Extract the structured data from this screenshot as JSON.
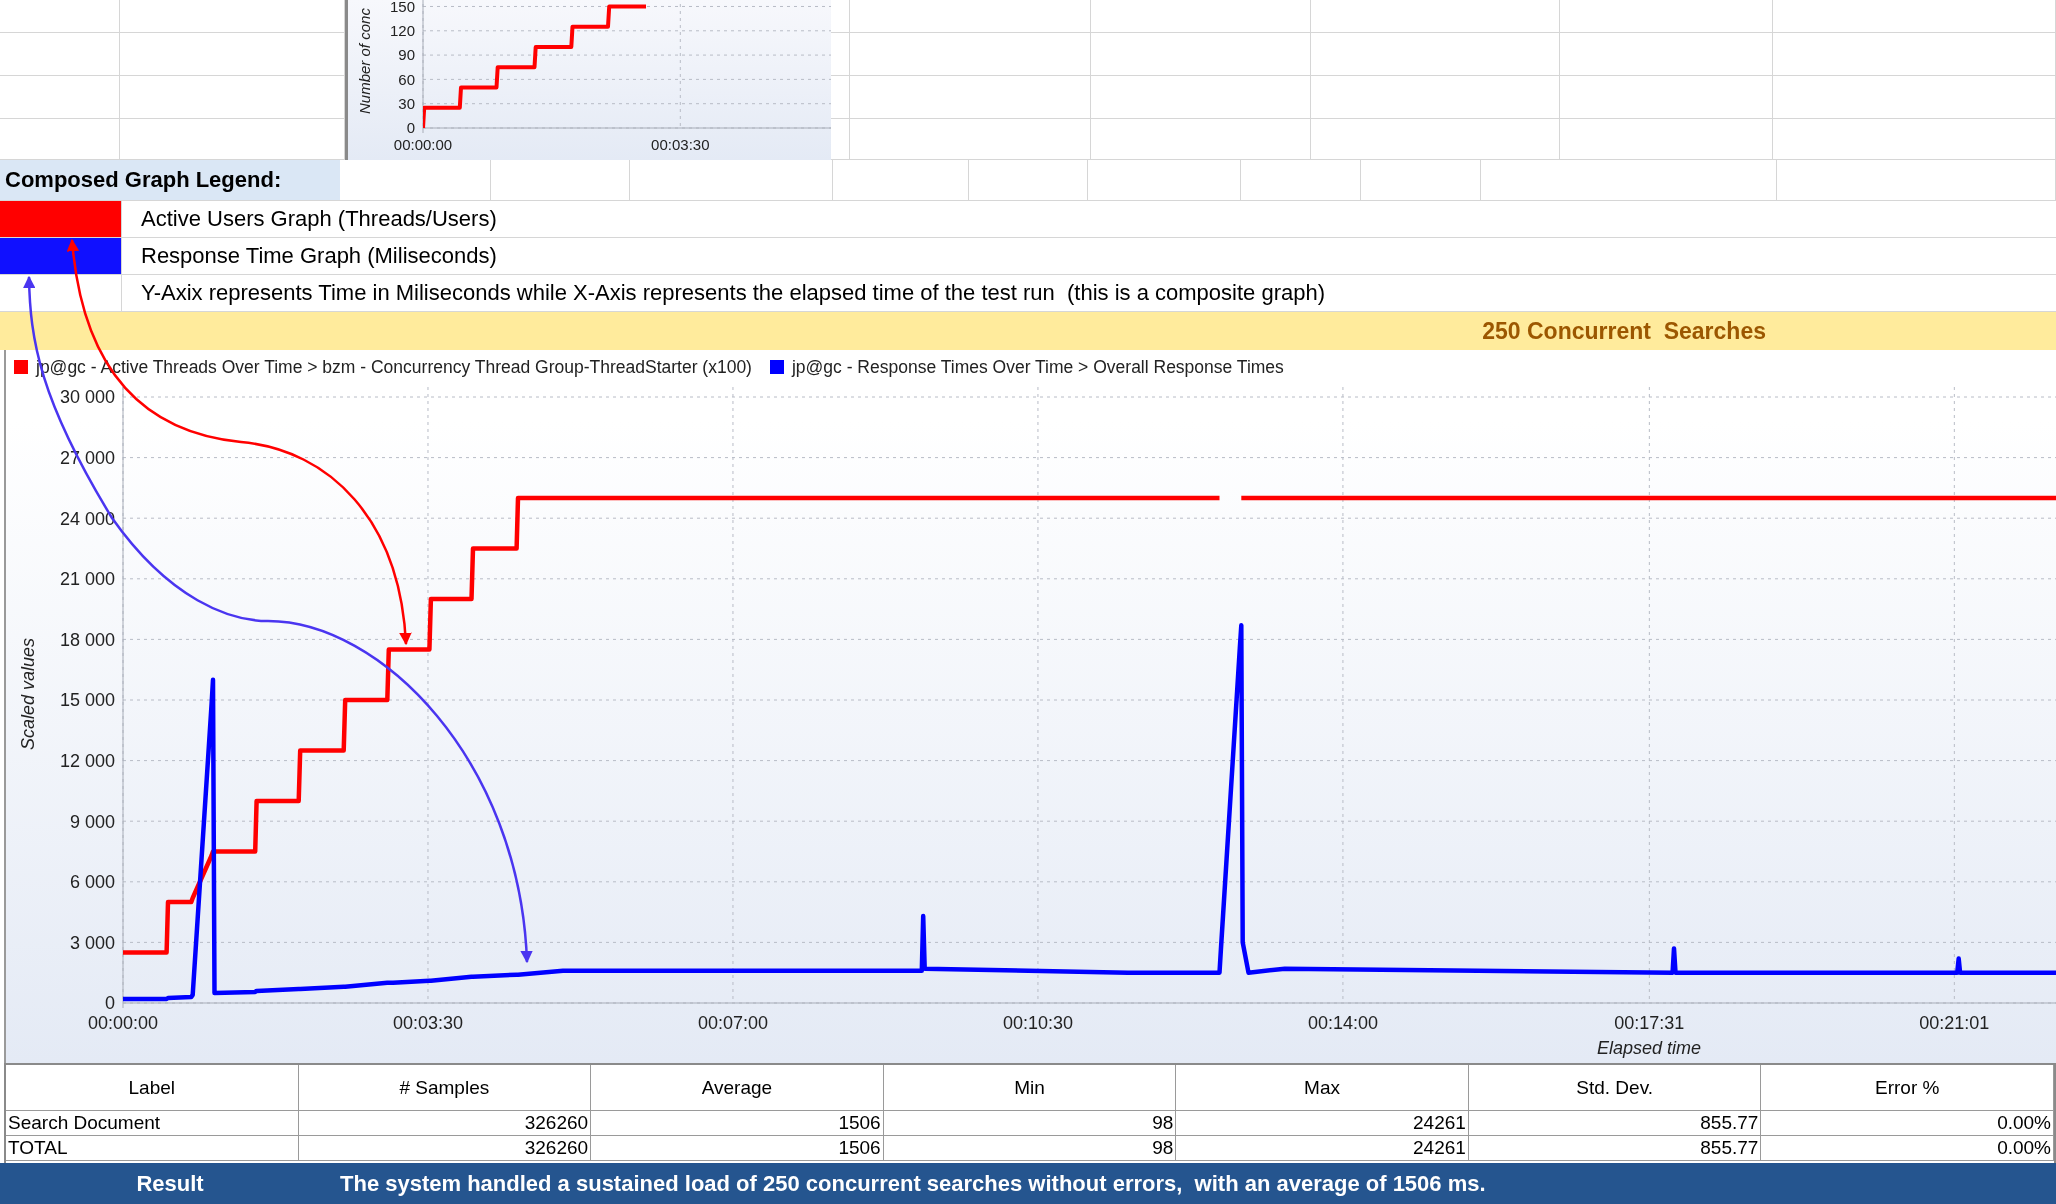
{
  "top_chart": {
    "chart_data": {
      "type": "line",
      "grid": true,
      "ylabel": "Number of conc",
      "x": [
        0,
        1,
        30,
        31,
        60,
        61,
        91,
        92,
        121,
        122,
        151,
        152,
        182
      ],
      "series": [
        {
          "color": "#ff0000",
          "values": [
            0,
            25,
            25,
            50,
            50,
            75,
            75,
            100,
            100,
            125,
            125,
            150,
            150
          ]
        }
      ],
      "xlim": [
        0,
        333
      ],
      "ylim": [
        0,
        158
      ],
      "yticks": [
        0,
        30,
        60,
        90,
        120,
        150
      ],
      "xticks": [
        {
          "value": 0,
          "label": "00:00:00"
        },
        {
          "value": 210,
          "label": "00:03:30"
        }
      ]
    }
  },
  "legend": {
    "title": "Composed Graph Legend:",
    "items": [
      {
        "label": "Active Users Graph (Threads/Users)",
        "color": "#ff0000"
      },
      {
        "label": "Response Time Graph (Miliseconds)",
        "color": "#1010ff"
      }
    ],
    "note": "Y-Axix represents Time in Miliseconds while X-Axis represents the elapsed time of the test run  (this is a composite graph)"
  },
  "banner": "250 Concurrent  Searches",
  "main_chart": {
    "chart_data": {
      "type": "line",
      "grid": true,
      "legend": "top",
      "xlabel": "Elapsed time",
      "ylabel": "Scaled values",
      "x": [
        0,
        30,
        31,
        47,
        48,
        61,
        62,
        63,
        91,
        92,
        121,
        122,
        152,
        153,
        182,
        183,
        186,
        211,
        212,
        240,
        241,
        271,
        272,
        303,
        550,
        551,
        552,
        692,
        755,
        756,
        769,
        770,
        771,
        775,
        800,
        1067,
        1068,
        1069,
        1263,
        1264,
        1265,
        1331
      ],
      "series": [
        {
          "name": "jp@gc - Active Threads Over Time > bzm - Concurrency Thread Group-ThreadStarter (x100)",
          "color": "#ff0000",
          "values": [
            2500,
            2500,
            5000,
            5000,
            5200,
            7300,
            7500,
            7500,
            7500,
            10000,
            10000,
            12500,
            12500,
            15000,
            15000,
            17500,
            17500,
            17500,
            20000,
            20000,
            22500,
            22500,
            25000,
            25000,
            25000,
            25000,
            25000,
            25000,
            25000,
            null,
            null,
            25000,
            25000,
            25000,
            25000,
            25000,
            25000,
            25000,
            25000,
            25000,
            25000,
            25000
          ]
        },
        {
          "name": "jp@gc - Response Times Over Time > Overall Response Times",
          "color": "#0000ff",
          "values": [
            200,
            200,
            250,
            300,
            400,
            14800,
            16000,
            500,
            550,
            600,
            700,
            700,
            800,
            800,
            1000,
            1000,
            1000,
            1100,
            1100,
            1300,
            1300,
            1400,
            1400,
            1600,
            1600,
            4300,
            1700,
            1500,
            1500,
            2650,
            17550,
            18700,
            3000,
            1500,
            1700,
            1500,
            2700,
            1500,
            1500,
            2200,
            1500,
            1500
          ]
        }
      ],
      "xlim": [
        0,
        1331
      ],
      "ylim": [
        0,
        30000
      ],
      "yticks": [
        {
          "value": 0,
          "label": "0"
        },
        {
          "value": 3000,
          "label": "3 000"
        },
        {
          "value": 6000,
          "label": "6 000"
        },
        {
          "value": 9000,
          "label": "9 000"
        },
        {
          "value": 12000,
          "label": "12 000"
        },
        {
          "value": 15000,
          "label": "15 000"
        },
        {
          "value": 18000,
          "label": "18 000"
        },
        {
          "value": 21000,
          "label": "21 000"
        },
        {
          "value": 24000,
          "label": "24 000"
        },
        {
          "value": 27000,
          "label": "27 000"
        },
        {
          "value": 30000,
          "label": "30 000"
        }
      ],
      "xticks": [
        {
          "value": 0,
          "label": "00:00:00"
        },
        {
          "value": 210,
          "label": "00:03:30"
        },
        {
          "value": 420,
          "label": "00:07:00"
        },
        {
          "value": 630,
          "label": "00:10:30"
        },
        {
          "value": 840,
          "label": "00:14:00"
        },
        {
          "value": 1051,
          "label": "00:17:31"
        },
        {
          "value": 1261,
          "label": "00:21:01"
        }
      ]
    }
  },
  "table": {
    "columns": [
      "Label",
      "# Samples",
      "Average",
      "Min",
      "Max",
      "Std. Dev.",
      "Error %"
    ],
    "rows": [
      [
        "Search Document",
        "326260",
        "1506",
        "98",
        "24261",
        "855.77",
        "0.00%"
      ],
      [
        "TOTAL",
        "326260",
        "1506",
        "98",
        "24261",
        "855.77",
        "0.00%"
      ]
    ]
  },
  "result": {
    "label": "Result",
    "text": "The system handled a sustained load of 250 concurrent searches without errors,  with an average of 1506 ms."
  }
}
